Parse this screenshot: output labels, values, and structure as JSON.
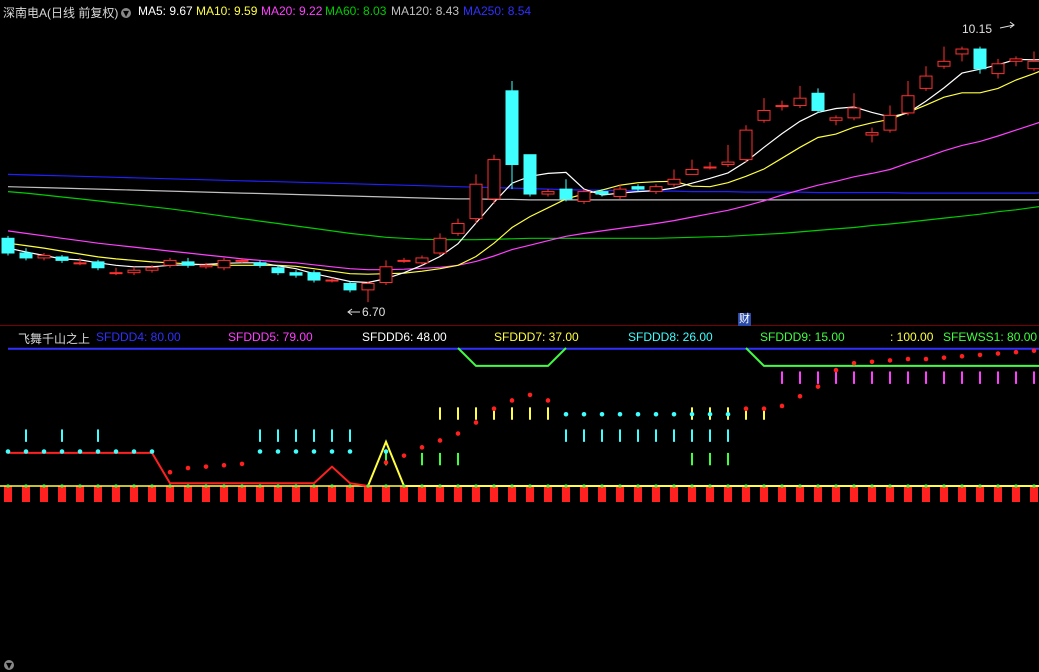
{
  "main_header": {
    "title": "深南电A(日线 前复权)",
    "ma5": "MA5: 9.67",
    "ma10": "MA10: 9.59",
    "ma20": "MA20: 9.22",
    "ma60": "MA60: 8.03",
    "ma120": "MA120: 8.43",
    "ma250": "MA250: 8.54"
  },
  "annotations": {
    "high_label": "10.15",
    "low_label": "6.70",
    "cai_badge": "财"
  },
  "sub_header": {
    "title": "飞舞千山之上",
    "sfddd4": "SFDDD4: 80.00",
    "sfddd5": "SFDDD5: 79.00",
    "sfddd6": "SFDDD6: 48.00",
    "sfddd7": "SFDDD7: 37.00",
    "sfddd8": "SFDDD8: 26.00",
    "sfddd9": "SFDDD9: 15.00",
    "unnamed": ": 100.00",
    "sfewss1": "SFEWSS1: 80.00"
  },
  "colors": {
    "ma5": "#ffffff",
    "ma10": "#ffff40",
    "ma20": "#ff40ff",
    "ma60": "#00cc00",
    "ma120": "#c0c0c0",
    "ma250": "#2020ff",
    "up": "#ff3030",
    "down": "#40ffff"
  },
  "chart_data": {
    "type": "candlestick",
    "candles": [
      [
        8.0,
        7.7,
        8.05,
        7.65
      ],
      [
        7.7,
        7.6,
        7.8,
        7.55
      ],
      [
        7.6,
        7.65,
        7.7,
        7.55
      ],
      [
        7.62,
        7.55,
        7.66,
        7.5
      ],
      [
        7.5,
        7.5,
        7.6,
        7.45
      ],
      [
        7.52,
        7.4,
        7.56,
        7.35
      ],
      [
        7.3,
        7.3,
        7.4,
        7.25
      ],
      [
        7.3,
        7.35,
        7.42,
        7.25
      ],
      [
        7.35,
        7.4,
        7.45,
        7.3
      ],
      [
        7.45,
        7.55,
        7.6,
        7.4
      ],
      [
        7.52,
        7.45,
        7.6,
        7.4
      ],
      [
        7.42,
        7.45,
        7.5,
        7.38
      ],
      [
        7.4,
        7.55,
        7.6,
        7.35
      ],
      [
        7.55,
        7.55,
        7.6,
        7.5
      ],
      [
        7.5,
        7.45,
        7.55,
        7.4
      ],
      [
        7.4,
        7.3,
        7.45,
        7.25
      ],
      [
        7.3,
        7.25,
        7.35,
        7.2
      ],
      [
        7.3,
        7.15,
        7.35,
        7.1
      ],
      [
        7.15,
        7.15,
        7.2,
        7.1
      ],
      [
        7.08,
        6.95,
        7.12,
        6.9
      ],
      [
        6.95,
        7.08,
        7.12,
        6.7
      ],
      [
        7.1,
        7.42,
        7.55,
        7.05
      ],
      [
        7.55,
        7.55,
        7.6,
        7.5
      ],
      [
        7.5,
        7.6,
        7.65,
        7.45
      ],
      [
        7.7,
        8.0,
        8.1,
        7.65
      ],
      [
        8.1,
        8.3,
        8.4,
        8.05
      ],
      [
        8.4,
        9.1,
        9.3,
        8.3
      ],
      [
        8.8,
        9.6,
        9.7,
        8.7
      ],
      [
        11.0,
        9.5,
        11.2,
        9.0
      ],
      [
        9.7,
        8.9,
        9.7,
        8.85
      ],
      [
        8.9,
        8.95,
        9.0,
        8.85
      ],
      [
        9.0,
        8.8,
        9.2,
        8.75
      ],
      [
        8.75,
        8.95,
        9.0,
        8.7
      ],
      [
        8.95,
        8.9,
        9.0,
        8.85
      ],
      [
        8.85,
        9.0,
        9.1,
        8.8
      ],
      [
        9.05,
        9.0,
        9.1,
        8.95
      ],
      [
        8.95,
        9.05,
        9.1,
        8.9
      ],
      [
        9.1,
        9.2,
        9.4,
        9.05
      ],
      [
        9.3,
        9.4,
        9.6,
        9.3
      ],
      [
        9.45,
        9.45,
        9.55,
        9.4
      ],
      [
        9.5,
        9.55,
        9.9,
        9.45
      ],
      [
        9.6,
        10.2,
        10.3,
        9.55
      ],
      [
        10.4,
        10.6,
        10.85,
        10.35
      ],
      [
        10.7,
        10.7,
        10.8,
        10.6
      ],
      [
        10.7,
        10.85,
        11.1,
        10.65
      ],
      [
        10.95,
        10.6,
        11.05,
        10.55
      ],
      [
        10.4,
        10.45,
        10.5,
        10.3
      ],
      [
        10.45,
        10.65,
        10.95,
        10.4
      ],
      [
        10.1,
        10.15,
        10.25,
        9.95
      ],
      [
        10.2,
        10.5,
        10.7,
        10.15
      ],
      [
        10.55,
        10.9,
        11.2,
        10.5
      ],
      [
        11.05,
        11.3,
        11.5,
        11.0
      ],
      [
        11.5,
        11.6,
        11.9,
        11.45
      ],
      [
        11.75,
        11.85,
        11.9,
        11.6
      ],
      [
        11.85,
        11.45,
        11.9,
        11.35
      ],
      [
        11.35,
        11.55,
        11.65,
        11.25
      ],
      [
        11.6,
        11.65,
        11.7,
        11.5
      ],
      [
        11.45,
        11.6,
        11.8,
        11.4
      ],
      [
        11.6,
        11.75,
        11.95,
        11.55
      ],
      [
        11.85,
        11.3,
        11.95,
        11.25
      ]
    ],
    "ma5": [
      7.8,
      7.72,
      7.65,
      7.58,
      7.56,
      7.5,
      7.45,
      7.42,
      7.42,
      7.45,
      7.46,
      7.47,
      7.49,
      7.5,
      7.5,
      7.44,
      7.38,
      7.28,
      7.2,
      7.12,
      7.1,
      7.18,
      7.3,
      7.45,
      7.63,
      7.89,
      8.31,
      8.73,
      9.12,
      9.26,
      9.32,
      9.34,
      9.0,
      8.88,
      8.92,
      8.95,
      8.97,
      9.02,
      9.12,
      9.22,
      9.33,
      9.56,
      9.85,
      10.13,
      10.38,
      10.56,
      10.64,
      10.67,
      10.56,
      10.47,
      10.55,
      10.79,
      11.06,
      11.36,
      11.44,
      11.53,
      11.64,
      11.63,
      11.64,
      11.56
    ],
    "ma10": [
      7.9,
      7.85,
      7.8,
      7.74,
      7.68,
      7.62,
      7.58,
      7.55,
      7.52,
      7.5,
      7.48,
      7.46,
      7.45,
      7.45,
      7.45,
      7.45,
      7.43,
      7.38,
      7.33,
      7.28,
      7.27,
      7.28,
      7.29,
      7.33,
      7.38,
      7.45,
      7.63,
      7.9,
      8.22,
      8.44,
      8.62,
      8.8,
      8.9,
      8.98,
      9.08,
      9.13,
      9.15,
      9.16,
      9.06,
      9.05,
      9.13,
      9.26,
      9.41,
      9.63,
      9.85,
      10.05,
      10.12,
      10.26,
      10.35,
      10.42,
      10.56,
      10.71,
      10.87,
      10.96,
      10.96,
      11.05,
      11.22,
      11.35,
      11.5,
      11.55
    ],
    "ma20": [
      8.15,
      8.1,
      8.05,
      8.0,
      7.95,
      7.9,
      7.86,
      7.82,
      7.78,
      7.74,
      7.7,
      7.66,
      7.62,
      7.58,
      7.55,
      7.52,
      7.5,
      7.46,
      7.42,
      7.38,
      7.36,
      7.36,
      7.37,
      7.39,
      7.41,
      7.45,
      7.53,
      7.64,
      7.77,
      7.86,
      7.95,
      8.04,
      8.1,
      8.15,
      8.2,
      8.25,
      8.3,
      8.36,
      8.43,
      8.5,
      8.57,
      8.66,
      8.76,
      8.88,
      8.98,
      9.08,
      9.16,
      9.25,
      9.32,
      9.4,
      9.53,
      9.65,
      9.78,
      9.89,
      9.97,
      10.08,
      10.2,
      10.32,
      10.44,
      10.5
    ],
    "ma60": [
      8.95,
      8.92,
      8.88,
      8.84,
      8.8,
      8.76,
      8.72,
      8.68,
      8.64,
      8.6,
      8.55,
      8.5,
      8.45,
      8.4,
      8.35,
      8.3,
      8.25,
      8.2,
      8.15,
      8.1,
      8.06,
      8.02,
      8.0,
      7.98,
      7.97,
      7.97,
      7.97,
      7.98,
      7.99,
      8.0,
      8.0,
      8.0,
      8.0,
      8.0,
      8.0,
      8.0,
      8.0,
      8.01,
      8.02,
      8.03,
      8.04,
      8.06,
      8.08,
      8.1,
      8.13,
      8.16,
      8.19,
      8.22,
      8.26,
      8.29,
      8.33,
      8.37,
      8.41,
      8.45,
      8.49,
      8.54,
      8.58,
      8.63,
      8.68,
      8.72
    ],
    "ma120": [
      9.05,
      9.04,
      9.03,
      9.02,
      9.01,
      9.0,
      8.99,
      8.98,
      8.97,
      8.96,
      8.95,
      8.94,
      8.93,
      8.92,
      8.91,
      8.9,
      8.89,
      8.88,
      8.87,
      8.86,
      8.85,
      8.84,
      8.83,
      8.82,
      8.81,
      8.8,
      8.8,
      8.79,
      8.79,
      8.78,
      8.78,
      8.78,
      8.78,
      8.78,
      8.78,
      8.78,
      8.78,
      8.78,
      8.78,
      8.78,
      8.78,
      8.78,
      8.78,
      8.78,
      8.78,
      8.78,
      8.78,
      8.78,
      8.78,
      8.78,
      8.78,
      8.78,
      8.78,
      8.78,
      8.78,
      8.78,
      8.78,
      8.78,
      8.79,
      8.79
    ],
    "ma250": [
      9.3,
      9.29,
      9.28,
      9.27,
      9.26,
      9.25,
      9.24,
      9.23,
      9.22,
      9.21,
      9.2,
      9.19,
      9.18,
      9.17,
      9.16,
      9.15,
      9.14,
      9.13,
      9.12,
      9.11,
      9.1,
      9.09,
      9.08,
      9.07,
      9.06,
      9.05,
      9.04,
      9.03,
      9.02,
      9.01,
      9.0,
      8.99,
      8.98,
      8.98,
      8.97,
      8.97,
      8.96,
      8.96,
      8.95,
      8.95,
      8.95,
      8.94,
      8.94,
      8.94,
      8.94,
      8.93,
      8.93,
      8.93,
      8.93,
      8.93,
      8.92,
      8.92,
      8.92,
      8.92,
      8.92,
      8.92,
      8.92,
      8.92,
      8.93,
      8.93
    ],
    "ylim": [
      6.5,
      12.4
    ],
    "high": 10.15,
    "low": 6.7
  },
  "sub_chart_data": {
    "red_dots": [
      null,
      null,
      null,
      null,
      null,
      null,
      null,
      null,
      null,
      10,
      13,
      14,
      15,
      16,
      null,
      null,
      null,
      null,
      null,
      null,
      null,
      17,
      22,
      28,
      33,
      38,
      46,
      56,
      62,
      66,
      62,
      null,
      null,
      null,
      null,
      null,
      null,
      null,
      null,
      null,
      null,
      56,
      56,
      58,
      65,
      72,
      84,
      89,
      90,
      91,
      92,
      92,
      93,
      94,
      95,
      96,
      97,
      98,
      98,
      99
    ],
    "cyan_dots": [
      25,
      25,
      25,
      25,
      25,
      25,
      25,
      25,
      25,
      null,
      null,
      null,
      null,
      null,
      25,
      25,
      25,
      25,
      25,
      25,
      null,
      25,
      null,
      null,
      null,
      null,
      null,
      null,
      null,
      null,
      null,
      52,
      52,
      52,
      52,
      52,
      52,
      52,
      52,
      52,
      52,
      null,
      null,
      null,
      null,
      null,
      null,
      null,
      null,
      null,
      null,
      null,
      null,
      null,
      null,
      null,
      null,
      null,
      null,
      null
    ],
    "cyan_ticks": [
      false,
      true,
      false,
      true,
      false,
      true,
      false,
      false,
      false,
      false,
      false,
      false,
      false,
      false,
      true,
      true,
      true,
      true,
      true,
      true,
      false,
      false,
      false,
      false,
      false,
      false,
      false,
      false,
      false,
      false,
      false,
      true,
      true,
      true,
      true,
      true,
      true,
      true,
      true,
      true,
      true,
      false,
      false,
      false,
      false,
      false,
      false,
      false,
      false,
      false,
      false,
      false,
      false,
      false,
      false,
      false,
      false,
      false,
      false,
      false
    ],
    "yellow_ticks": [
      false,
      false,
      false,
      false,
      false,
      false,
      false,
      false,
      false,
      false,
      false,
      false,
      false,
      false,
      false,
      false,
      false,
      false,
      false,
      false,
      false,
      false,
      false,
      false,
      true,
      true,
      true,
      true,
      true,
      true,
      true,
      false,
      false,
      false,
      false,
      false,
      false,
      false,
      true,
      true,
      true,
      true,
      true,
      false,
      false,
      false,
      false,
      false,
      false,
      false,
      false,
      false,
      false,
      false,
      false,
      false,
      false,
      false,
      false,
      false
    ],
    "green_ticks": [
      false,
      false,
      false,
      false,
      false,
      false,
      false,
      false,
      false,
      false,
      false,
      false,
      false,
      false,
      false,
      false,
      false,
      false,
      false,
      false,
      false,
      true,
      false,
      true,
      true,
      true,
      false,
      false,
      false,
      false,
      false,
      false,
      false,
      false,
      false,
      false,
      false,
      false,
      true,
      true,
      true,
      false,
      false,
      false,
      false,
      false,
      false,
      false,
      false,
      false,
      false,
      false,
      false,
      false,
      false,
      false,
      false,
      false,
      false,
      false
    ],
    "magenta_ticks": [
      false,
      false,
      false,
      false,
      false,
      false,
      false,
      false,
      false,
      false,
      false,
      false,
      false,
      false,
      false,
      false,
      false,
      false,
      false,
      false,
      false,
      false,
      false,
      false,
      false,
      false,
      false,
      false,
      false,
      false,
      false,
      false,
      false,
      false,
      false,
      false,
      false,
      false,
      false,
      false,
      false,
      false,
      false,
      true,
      true,
      true,
      true,
      true,
      true,
      true,
      true,
      true,
      true,
      true,
      true,
      true,
      true,
      true,
      true,
      true
    ],
    "red_line": [
      [
        0,
        24
      ],
      [
        8,
        24
      ],
      [
        9,
        2
      ],
      [
        17,
        2
      ],
      [
        18,
        14
      ],
      [
        19,
        2
      ],
      [
        20,
        0
      ]
    ],
    "yellow_line": [
      [
        20,
        0
      ],
      [
        21,
        32
      ],
      [
        22,
        0
      ],
      [
        59,
        0
      ]
    ],
    "green_line": [
      [
        25,
        100
      ],
      [
        26,
        87
      ],
      [
        30,
        87
      ],
      [
        31,
        100
      ]
    ],
    "green_line2": [
      [
        41,
        100
      ],
      [
        42,
        87
      ],
      [
        59,
        87
      ]
    ],
    "blue_line": [
      [
        0,
        99.5
      ],
      [
        59,
        99.5
      ]
    ]
  }
}
